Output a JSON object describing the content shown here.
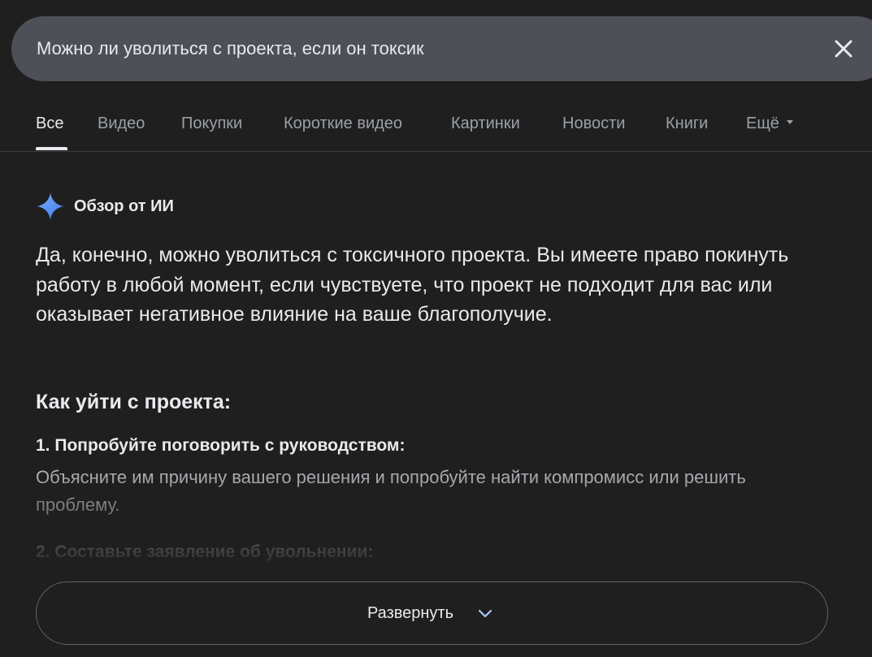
{
  "search": {
    "query": "Можно ли уволиться с проекта, если он токсик",
    "clear_icon": "close-icon"
  },
  "tabs": [
    {
      "label": "Все",
      "active": true
    },
    {
      "label": "Видео",
      "active": false
    },
    {
      "label": "Покупки",
      "active": false
    },
    {
      "label": "Короткие видео",
      "active": false
    },
    {
      "label": "Картинки",
      "active": false
    },
    {
      "label": "Новости",
      "active": false
    },
    {
      "label": "Книги",
      "active": false
    },
    {
      "label": "Ещё",
      "active": false
    }
  ],
  "ai_overview": {
    "icon": "sparkle-icon",
    "title": "Обзор от ИИ",
    "answer": "Да, конечно, можно уволиться с токсичного проекта. Вы имеете право покинуть работу в любой момент, если чувствуете, что проект не подходит для вас или оказывает негативное влияние на ваше благополучие.",
    "section_title": "Как уйти с проекта:",
    "steps": [
      {
        "title": "1. Попробуйте поговорить с руководством:",
        "description": "Объясните им причину вашего решения и попробуйте найти компромисс или решить проблему."
      },
      {
        "title": "2. Составьте заявление об увольнении:",
        "description": ""
      }
    ]
  },
  "expand": {
    "label": "Развернуть",
    "icon": "chevron-down-icon"
  },
  "colors": {
    "background": "#1f1f1f",
    "search_bar": "#4d5057",
    "text_primary": "#e8eaed",
    "text_secondary": "#9aa0a6",
    "sparkle": "#4c8df6"
  }
}
